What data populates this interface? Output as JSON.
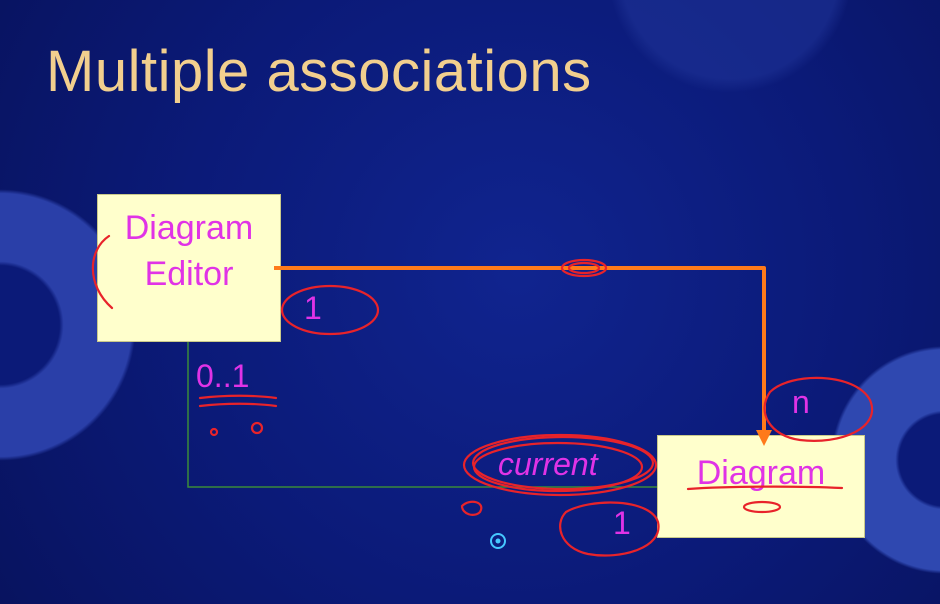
{
  "slide": {
    "title": "Multiple associations"
  },
  "diagram": {
    "classes": [
      {
        "id": "diagram-editor",
        "lines": [
          "Diagram",
          "Editor"
        ]
      },
      {
        "id": "diagram",
        "lines": [
          "Diagram"
        ]
      }
    ],
    "associations": [
      {
        "from": "diagram-editor",
        "to": "diagram",
        "source_multiplicity": "1",
        "target_multiplicity": "n"
      },
      {
        "from": "diagram-editor",
        "to": "diagram",
        "role": "current",
        "source_multiplicity": "0..1",
        "target_multiplicity": "1"
      }
    ]
  },
  "colors": {
    "background": "#0b1a78",
    "title": "#f2cf8e",
    "class_fill": "#ffffcc",
    "class_text": "#e033e6",
    "association_line": "#3a8a3a",
    "annotation_arrow": "#ff7a1a",
    "annotation_ink": "#e8232a"
  }
}
